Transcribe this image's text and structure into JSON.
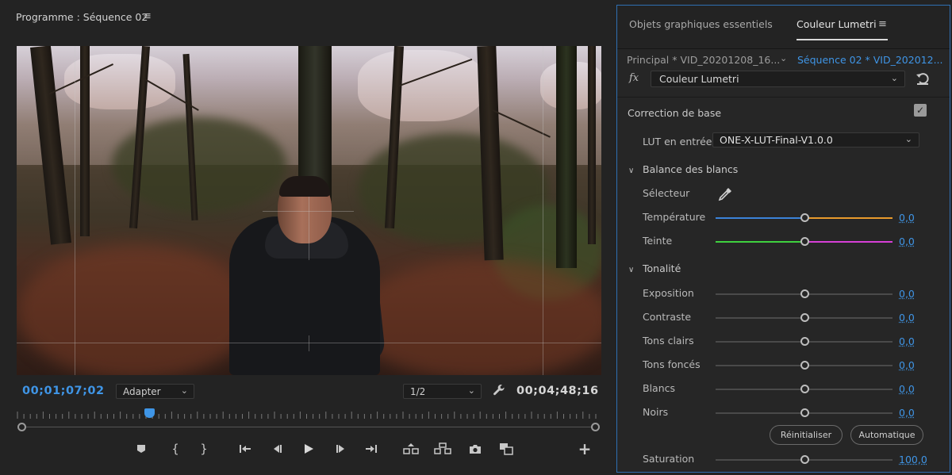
{
  "monitor": {
    "title": "Programme : Séquence 02",
    "menu_glyph": "≡",
    "current_timecode": "00;01;07;02",
    "fit_select": "Adapter",
    "resolution_select": "1/2",
    "duration_timecode": "00;04;48;16"
  },
  "panel": {
    "tabs": [
      {
        "label": "Objets graphiques essentiels",
        "active": false
      },
      {
        "label": "Couleur Lumetri",
        "active": true
      }
    ],
    "menu_glyph": "≡",
    "clip_principal": "Principal * VID_20201208_16...",
    "clip_sequence": "Séquence 02 * VID_202012...",
    "fx_label": "fx",
    "effect_select": "Couleur Lumetri",
    "basic_correction": {
      "label": "Correction de base",
      "enabled": true,
      "lut_label": "LUT en entrée",
      "lut_value": "ONE-X-LUT-Final-V1.0.0"
    },
    "white_balance": {
      "label": "Balance des blancs",
      "selector_label": "Sélecteur",
      "sliders": [
        {
          "label": "Température",
          "value": "0,0",
          "fraction": 0.5,
          "gradient": [
            "#3b82d8",
            "#e89a2c"
          ]
        },
        {
          "label": "Teinte",
          "value": "0,0",
          "fraction": 0.5,
          "gradient": [
            "#3fd13f",
            "#d63fd6"
          ]
        }
      ]
    },
    "tone": {
      "label": "Tonalité",
      "sliders": [
        {
          "label": "Exposition",
          "value": "0,0",
          "fraction": 0.5
        },
        {
          "label": "Contraste",
          "value": "0,0",
          "fraction": 0.5
        },
        {
          "label": "Tons clairs",
          "value": "0,0",
          "fraction": 0.5
        },
        {
          "label": "Tons foncés",
          "value": "0,0",
          "fraction": 0.5
        },
        {
          "label": "Blancs",
          "value": "0,0",
          "fraction": 0.5
        },
        {
          "label": "Noirs",
          "value": "0,0",
          "fraction": 0.5
        }
      ],
      "reset_label": "Réinitialiser",
      "auto_label": "Automatique"
    },
    "saturation": {
      "label": "Saturation",
      "value": "100,0",
      "fraction": 0.5
    }
  },
  "colors": {
    "accent_blue": "#3f95e6",
    "panel_border": "#2f6fb3"
  },
  "icons": [
    "menu-icon",
    "wrench-icon",
    "eyedropper-icon",
    "reset-icon",
    "checkbox-icon",
    "marker-icon",
    "in-point-icon",
    "out-point-icon",
    "go-to-in-icon",
    "step-back-icon",
    "play-icon",
    "step-forward-icon",
    "go-to-out-icon",
    "lift-icon",
    "extract-icon",
    "camera-icon",
    "compare-icon",
    "add-icon"
  ]
}
